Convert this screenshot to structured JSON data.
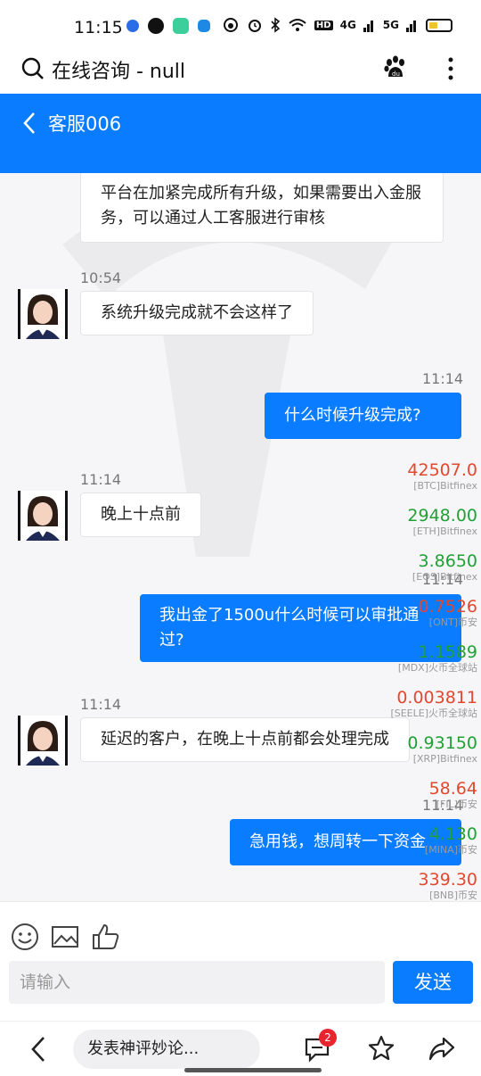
{
  "status_bar": {
    "time": "11:15",
    "right_labels": [
      "HD",
      "4G",
      "5G"
    ],
    "battery_color": "#f2c12e"
  },
  "browser": {
    "title": "在线咨询 - null",
    "icons": [
      "search-icon",
      "baidu-paw-icon",
      "more-icon"
    ]
  },
  "header": {
    "title": "客服006",
    "accent": "#0a7cff"
  },
  "chat": {
    "messages": [
      {
        "side": "in",
        "text": "平台在加紧完成所有升级，如果需要出入金服务，可以通过人工客服进行审核",
        "time": ""
      },
      {
        "side": "in",
        "text": "系统升级完成就不会这样了",
        "time": "10:54"
      },
      {
        "side": "out",
        "text": "什么时候升级完成?",
        "time": "11:14"
      },
      {
        "side": "in",
        "text": "晚上十点前",
        "time": "11:14"
      },
      {
        "side": "out",
        "text": "我出金了1500u什么时候可以审批通过?",
        "time": "11:14"
      },
      {
        "side": "in",
        "text": "延迟的客户，在晚上十点前都会处理完成",
        "time": "11:14"
      },
      {
        "side": "out",
        "text": "急用钱，想周转一下资金",
        "time": "11:14"
      }
    ]
  },
  "ticker": [
    {
      "price": "42507.0",
      "source": "[BTC]Bitfinex",
      "trend": "down"
    },
    {
      "price": "2948.00",
      "source": "[ETH]Bitfinex",
      "trend": "up"
    },
    {
      "price": "3.8650",
      "source": "[EOS]Bitfinex",
      "trend": "up"
    },
    {
      "price": "0.7526",
      "source": "[ONT]币安",
      "trend": "down"
    },
    {
      "price": "1.1589",
      "source": "[MDX]火币全球站",
      "trend": "up"
    },
    {
      "price": "0.003811",
      "source": "[SEELE]火币全球站",
      "trend": "down"
    },
    {
      "price": "0.93150",
      "source": "[XRP]Bitfinex",
      "trend": "up"
    },
    {
      "price": "58.64",
      "source": "[FIL]币安",
      "trend": "down"
    },
    {
      "price": "4.130",
      "source": "[MINA]币安",
      "trend": "up"
    },
    {
      "price": "339.30",
      "source": "[BNB]币安",
      "trend": "down"
    }
  ],
  "composer": {
    "placeholder": "请输入",
    "send_label": "发送",
    "tools": [
      "emoji-icon",
      "image-icon",
      "like-icon"
    ]
  },
  "bottom_nav": {
    "comment_placeholder": "发表神评妙论...",
    "comment_badge": "2"
  }
}
